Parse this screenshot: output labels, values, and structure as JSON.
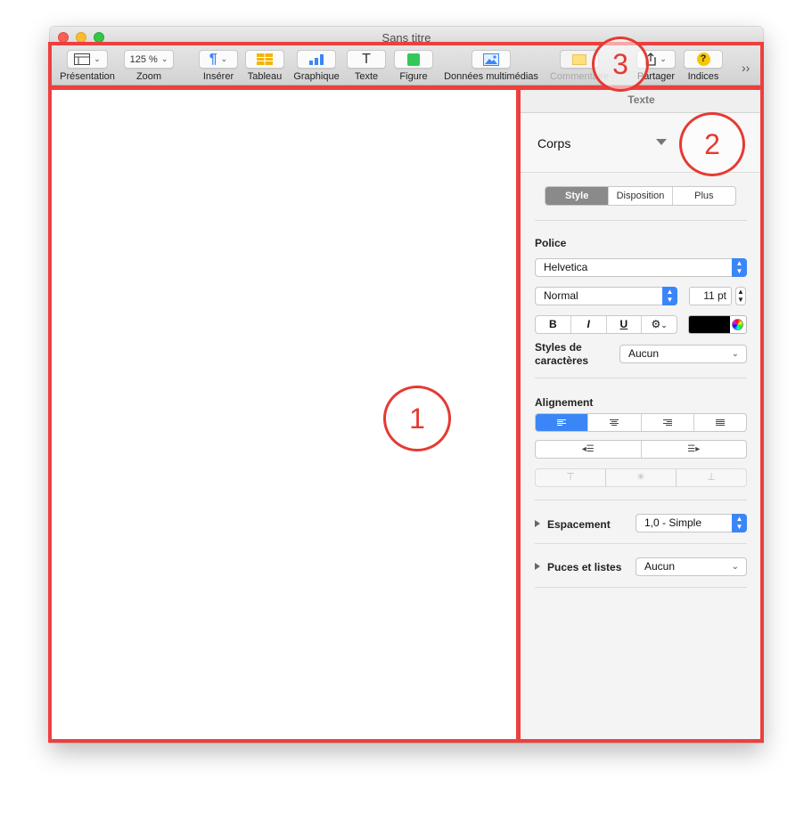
{
  "window": {
    "title": "Sans titre"
  },
  "toolbar": {
    "presentation": "Présentation",
    "zoom_value": "125 %",
    "zoom": "Zoom",
    "inserer": "Insérer",
    "tableau": "Tableau",
    "graphique": "Graphique",
    "texte": "Texte",
    "figure": "Figure",
    "donnees": "Données multimédias",
    "commentaire": "Commentaire",
    "partager": "Partager",
    "indices": "Indices",
    "more": "››"
  },
  "inspector": {
    "header": "Texte",
    "paragraph_style": "Corps",
    "tabs": [
      "Style",
      "Disposition",
      "Plus"
    ],
    "police_title": "Police",
    "font_family": "Helvetica",
    "font_style": "Normal",
    "font_size": "11 pt",
    "bold": "B",
    "italic": "I",
    "underline": "U",
    "char_styles_label": "Styles de caractères",
    "char_styles_value": "Aucun",
    "alignment_title": "Alignement",
    "spacing_label": "Espacement",
    "spacing_value": "1,0 - Simple",
    "bullets_label": "Puces et listes",
    "bullets_value": "Aucun"
  },
  "annotations": [
    "1",
    "2",
    "3"
  ],
  "colors": {
    "annotation": "#ee3f3f",
    "accent": "#3b86f7",
    "font_color": "#000000"
  }
}
